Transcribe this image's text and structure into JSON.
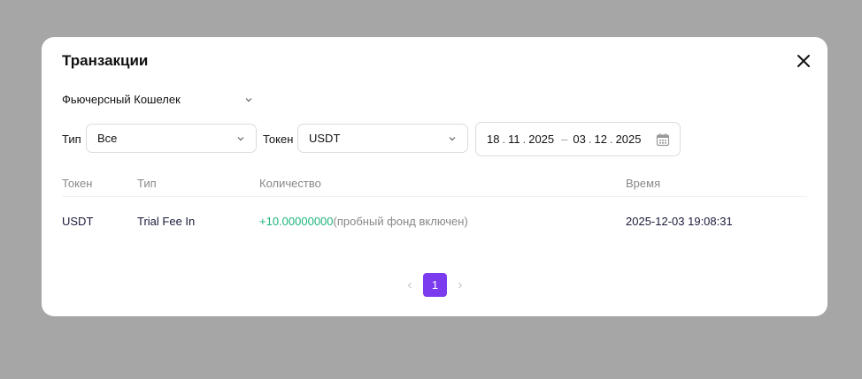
{
  "modal": {
    "title": "Транзакции",
    "close_icon": "close-icon"
  },
  "wallet_select": {
    "value": "Фьючерсный Кошелек",
    "icon": "chevron-down-icon"
  },
  "filters": {
    "type_label": "Тип",
    "type_value": "Все",
    "token_label": "Токен",
    "token_value": "USDT",
    "date_from": {
      "day": "18",
      "month": "11",
      "year": "2025"
    },
    "date_to": {
      "day": "03",
      "month": "12",
      "year": "2025"
    },
    "date_sep": ".",
    "range_sep": "–",
    "calendar_icon": "calendar-icon"
  },
  "table": {
    "headers": [
      "Токен",
      "Тип",
      "Количество",
      "Время"
    ],
    "rows": [
      {
        "token": "USDT",
        "type": "Trial Fee In",
        "amount": "+10.00000000",
        "note": "(пробный фонд включен)",
        "time": "2025-12-03 19:08:31"
      }
    ]
  },
  "pagination": {
    "current_page": "1",
    "prev_icon": "chevron-left-icon",
    "next_icon": "chevron-right-icon"
  },
  "colors": {
    "overlay": "#a6a6a6",
    "accent": "#7b3cf0",
    "positive": "#1fb57a"
  }
}
